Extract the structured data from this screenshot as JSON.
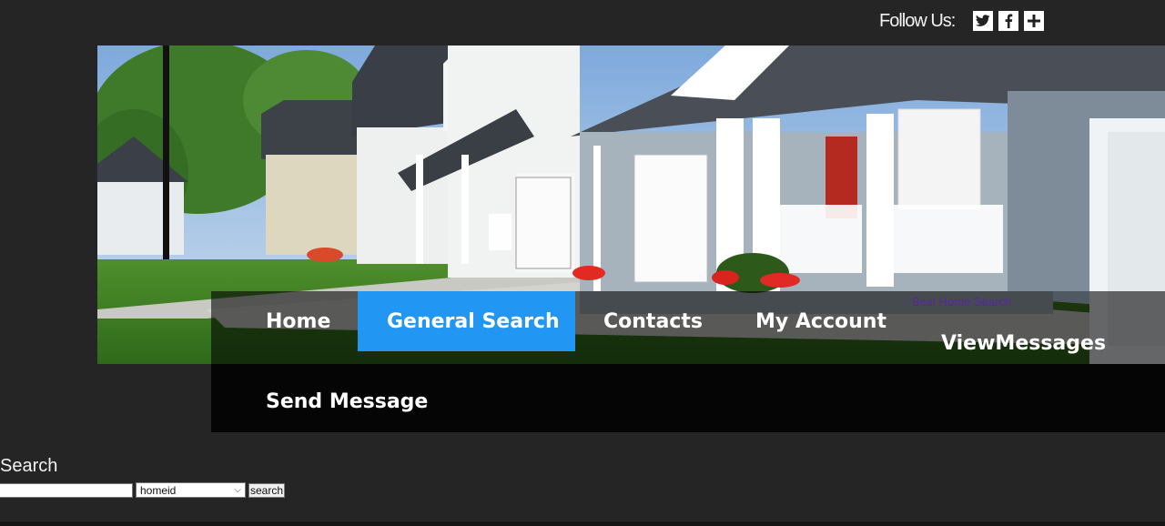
{
  "follow": {
    "label": "Follow Us:",
    "icons": [
      "twitter-icon",
      "facebook-icon",
      "plus-icon"
    ]
  },
  "hero": {
    "image": "suburban-houses-photo"
  },
  "nav": {
    "items": [
      {
        "label": "Home",
        "active": false
      },
      {
        "label": "General Search",
        "active": true
      },
      {
        "label": "Contacts",
        "active": false
      },
      {
        "label": "My Account",
        "active": false
      },
      {
        "label": "ViewMessages",
        "active": false
      },
      {
        "label": "Send Message",
        "active": false
      }
    ],
    "brand_link": "Best Home Search",
    "active_color": "#2196f3"
  },
  "search": {
    "title": "Search",
    "input_value": "",
    "select_value": "homeid",
    "button_label": "search"
  },
  "colors": {
    "background": "#252525",
    "accent": "#2196f3",
    "brand_link": "#5a24a8"
  }
}
